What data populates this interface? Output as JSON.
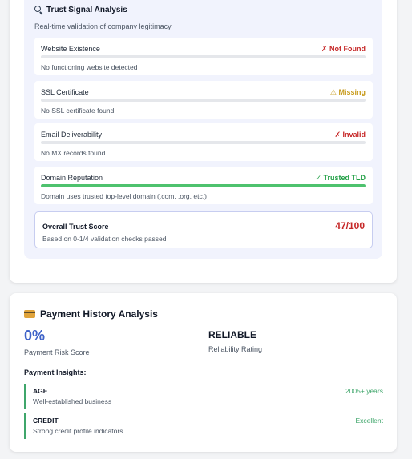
{
  "trust": {
    "title": "Trust Signal Analysis",
    "subtitle": "Real-time validation of company legitimacy",
    "checks": [
      {
        "label": "Website Existence",
        "status": "✗ Not Found",
        "status_color": "#c62828",
        "description": "No functioning website detected",
        "progress": 0
      },
      {
        "label": "SSL Certificate",
        "status": "⚠ Missing",
        "status_color": "#c79a1a",
        "description": "No SSL certificate found",
        "progress": 0
      },
      {
        "label": "Email Deliverability",
        "status": "✗ Invalid",
        "status_color": "#c62828",
        "description": "No MX records found",
        "progress": 0
      },
      {
        "label": "Domain Reputation",
        "status": "✓ Trusted TLD",
        "status_color": "#22a046",
        "description": "Domain uses trusted top-level domain (.com, .org, etc.)",
        "progress": 1
      }
    ],
    "overall": {
      "label": "Overall Trust Score",
      "description": "Based on 0-1/4 validation checks passed",
      "score": "47/100"
    }
  },
  "payment": {
    "title": "Payment History Analysis",
    "risk_score": "0%",
    "risk_label": "Payment Risk Score",
    "reliability": "RELIABLE",
    "reliability_label": "Reliability Rating",
    "insights_title": "Payment Insights:",
    "insights": [
      {
        "key": "AGE",
        "description": "Well-established business",
        "value": "2005+ years"
      },
      {
        "key": "CREDIT",
        "description": "Strong credit profile indicators",
        "value": "Excellent"
      }
    ]
  },
  "colors": {
    "accent_blue": "#3f63c8",
    "danger": "#c62828",
    "warning": "#c79a1a",
    "success": "#22a046"
  },
  "icons": {
    "trust": "magnifier-icon",
    "payment": "credit-card-icon"
  }
}
